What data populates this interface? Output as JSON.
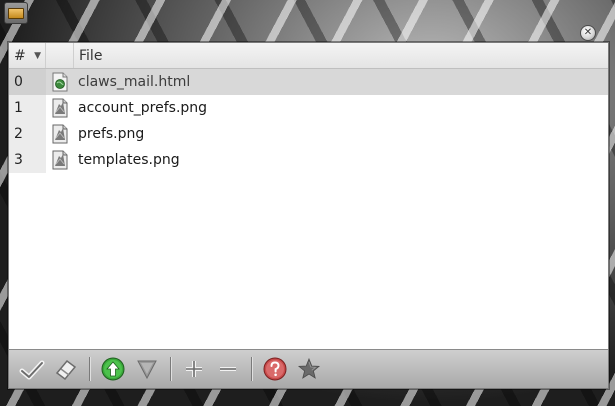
{
  "window": {
    "close_glyph": "✕"
  },
  "header": {
    "num_label": "#",
    "sort_glyph": "▼",
    "file_label": "File"
  },
  "rows": [
    {
      "num": "0",
      "file": "claws_mail.html",
      "icon": "html-file-icon",
      "selected": true
    },
    {
      "num": "1",
      "file": "account_prefs.png",
      "icon": "image-file-icon",
      "selected": false
    },
    {
      "num": "2",
      "file": "prefs.png",
      "icon": "image-file-icon",
      "selected": false
    },
    {
      "num": "3",
      "file": "templates.png",
      "icon": "image-file-icon",
      "selected": false
    }
  ],
  "toolbar": {
    "buttons": [
      {
        "name": "check-all-button",
        "icon": "checkmark-icon"
      },
      {
        "name": "uncheck-all-button",
        "icon": "erase-icon"
      },
      {
        "name": "move-up-button",
        "icon": "up-arrow-icon"
      },
      {
        "name": "move-down-button",
        "icon": "down-arrow-icon"
      },
      {
        "name": "add-button",
        "icon": "plus-icon"
      },
      {
        "name": "remove-button",
        "icon": "minus-icon"
      },
      {
        "name": "help-button",
        "icon": "question-icon"
      },
      {
        "name": "favorite-button",
        "icon": "star-icon"
      }
    ]
  },
  "colors": {
    "selected_row": "#d8d8d8",
    "number_column": "#ececec",
    "toolbar": "#bdbdbd",
    "up_green": "#3aa83a",
    "help_red": "#c84a4a"
  }
}
